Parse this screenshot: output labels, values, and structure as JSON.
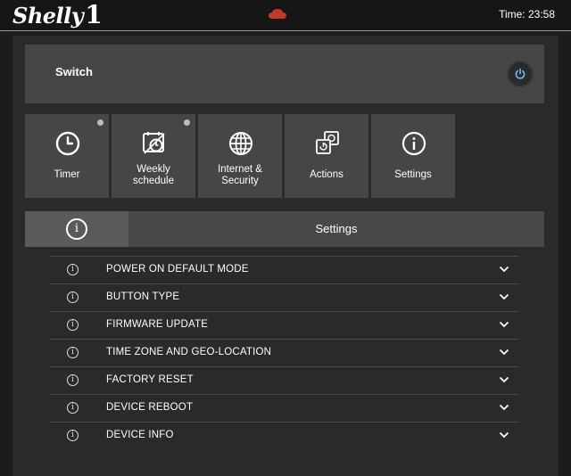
{
  "header": {
    "logo_text": "Shelly",
    "logo_number": "1",
    "cloud_icon": "cloud-icon",
    "cloud_color": "#c0392b",
    "time": "Time: 23:58"
  },
  "switch_card": {
    "label": "Switch",
    "power_icon": "power-icon"
  },
  "tiles": [
    {
      "label": "Timer",
      "icon": "clock-icon",
      "has_dot": true
    },
    {
      "label": "Weekly\nschedule",
      "icon": "schedule-icon",
      "has_dot": true
    },
    {
      "label": "Internet &\nSecurity",
      "icon": "globe-icon",
      "has_dot": false
    },
    {
      "label": "Actions",
      "icon": "actions-icon",
      "has_dot": false
    },
    {
      "label": "Settings",
      "icon": "info-icon",
      "has_dot": false
    }
  ],
  "settings_tab": {
    "info_icon_text": "i",
    "title": "Settings"
  },
  "settings_list": [
    {
      "label": "POWER ON DEFAULT MODE"
    },
    {
      "label": "BUTTON TYPE"
    },
    {
      "label": "FIRMWARE UPDATE"
    },
    {
      "label": "TIME ZONE AND GEO-LOCATION"
    },
    {
      "label": "FACTORY RESET"
    },
    {
      "label": "DEVICE REBOOT"
    },
    {
      "label": "DEVICE INFO"
    }
  ],
  "colors": {
    "background": "#1c1c1c",
    "panel": "#2a2a2a",
    "card": "#454545",
    "accent_dot": "#bdbdbd"
  }
}
